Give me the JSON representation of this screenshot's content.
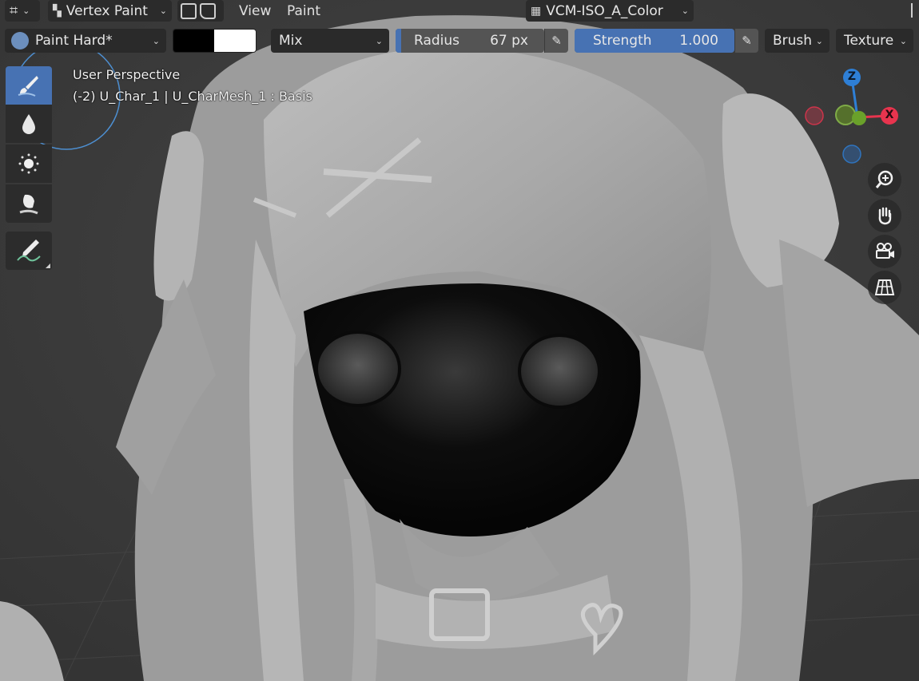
{
  "header": {
    "mode_label": "Vertex Paint",
    "menus": [
      "View",
      "Paint"
    ],
    "color_attribute": "VCM-ISO_A_Color"
  },
  "toolbar": {
    "brush_name": "Paint Hard*",
    "blend_mode": "Mix",
    "radius": {
      "label": "Radius",
      "value": "67 px",
      "fill_fraction": 0.04
    },
    "strength": {
      "label": "Strength",
      "value": "1.000",
      "fill_fraction": 1.0
    },
    "brush_menu": "Brush",
    "texture_menu": "Texture",
    "colors": {
      "primary": "#000000",
      "secondary": "#ffffff"
    }
  },
  "tools": [
    {
      "name": "draw",
      "icon": "paint-brush-icon",
      "active": true
    },
    {
      "name": "blur",
      "icon": "drop-icon",
      "active": false
    },
    {
      "name": "average",
      "icon": "dots-icon",
      "active": false
    },
    {
      "name": "smear",
      "icon": "smear-finger-icon",
      "active": false
    },
    {
      "name": "annotate",
      "icon": "annotate-pen-icon",
      "active": false
    }
  ],
  "overlay": {
    "view_name": "User Perspective",
    "object_info": "(-2) U_Char_1 | U_CharMesh_1 : Basis"
  },
  "gizmo": {
    "z_label": "Z",
    "x_label": "X",
    "x_color": "#e8344e",
    "y_color": "#6aa12a",
    "z_color": "#2e7fd6"
  },
  "nav_buttons": [
    "zoom-icon",
    "pan-hand-icon",
    "camera-icon",
    "grid-view-icon"
  ],
  "theme": {
    "accent": "#4772b3",
    "panel": "#2b2b2b"
  }
}
